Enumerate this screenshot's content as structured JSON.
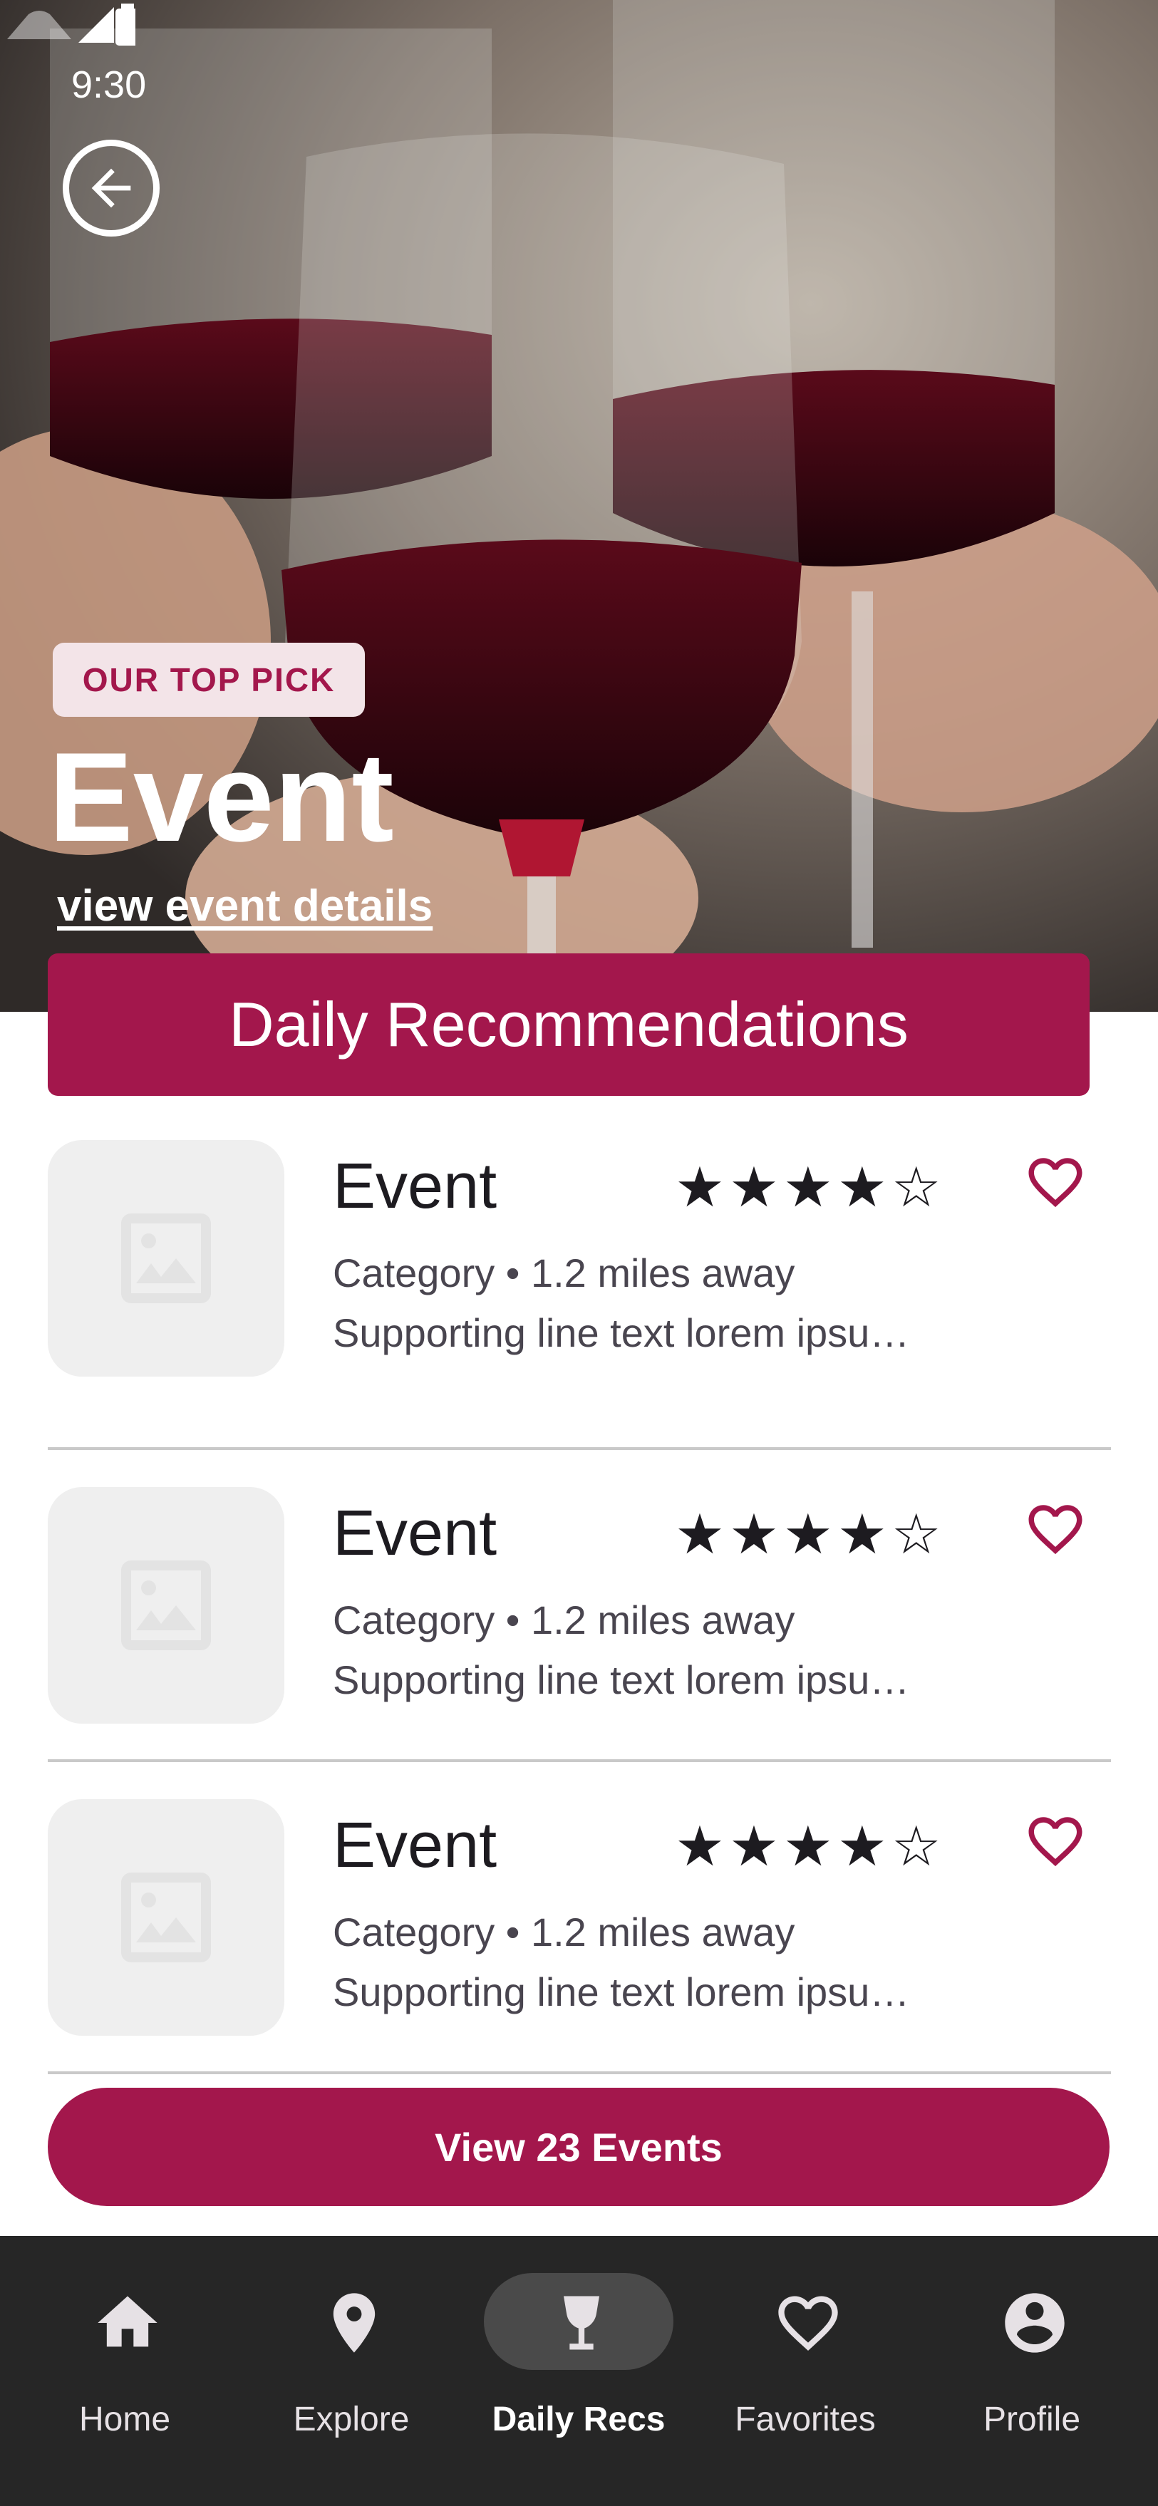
{
  "status_bar": {
    "time": "9:30"
  },
  "hero": {
    "badge": "OUR TOP PICK",
    "title": "Event",
    "link": "view event details"
  },
  "section": {
    "title": "Daily Recommendations"
  },
  "events": [
    {
      "title": "Event",
      "rating": 4,
      "meta": "Category • 1.2 miles away",
      "support": "Supporting line text lorem ipsu…"
    },
    {
      "title": "Event",
      "rating": 4,
      "meta": "Category • 1.2 miles away",
      "support": "Supporting line text lorem ipsu…"
    },
    {
      "title": "Event",
      "rating": 4,
      "meta": "Category • 1.2 miles away",
      "support": "Supporting line text lorem ipsu…"
    }
  ],
  "cta": {
    "label": "View 23 Events"
  },
  "nav": {
    "items": [
      {
        "label": "Home",
        "icon": "home-icon"
      },
      {
        "label": "Explore",
        "icon": "location-pin-icon"
      },
      {
        "label": "Daily Recs",
        "icon": "wine-glass-icon",
        "active": true
      },
      {
        "label": "Favorites",
        "icon": "heart-icon"
      },
      {
        "label": "Profile",
        "icon": "account-circle-icon"
      }
    ]
  },
  "colors": {
    "accent": "#a3174c",
    "badge_bg": "#f3e4e8",
    "nav_bg": "#262626"
  }
}
